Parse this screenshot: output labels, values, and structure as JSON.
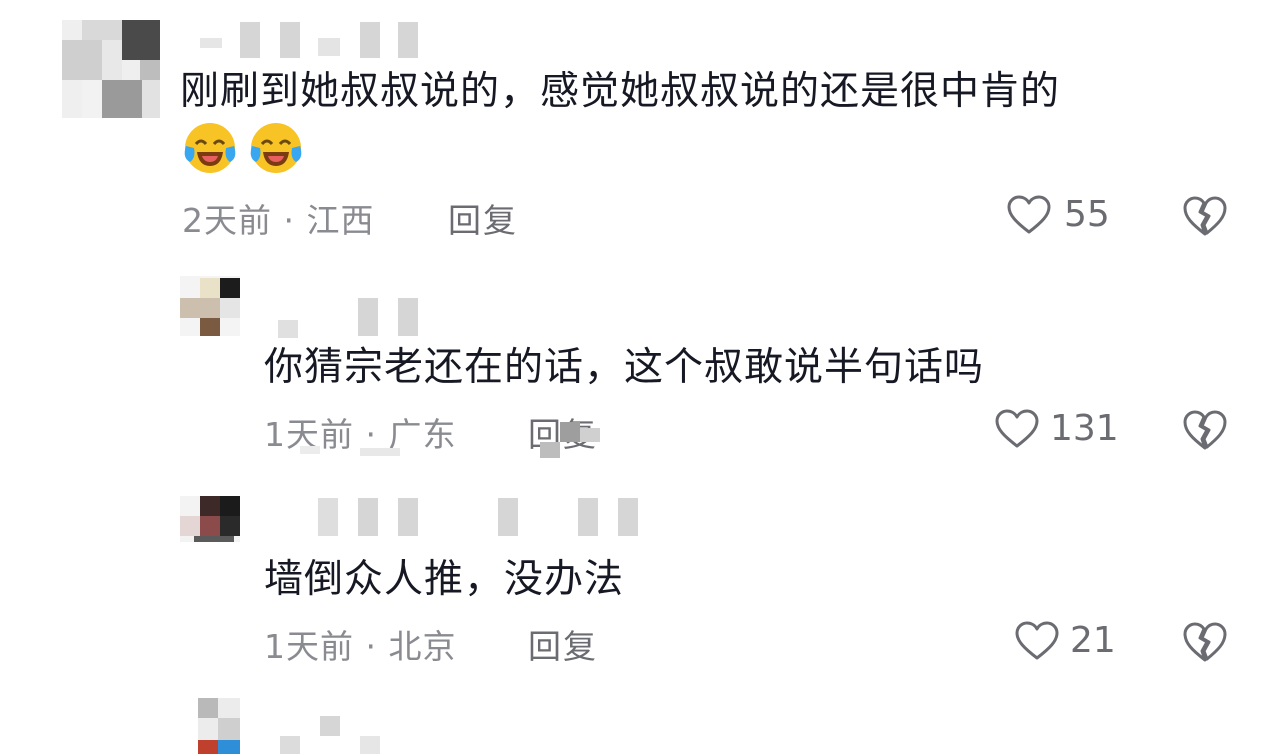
{
  "comments": [
    {
      "text": "刚刷到她叔叔说的，感觉她叔叔说的还是很中肯的",
      "emojis": [
        "laughing-crying-emoji",
        "laughing-crying-emoji"
      ],
      "time": "2天前",
      "sep": "·",
      "location": "江西",
      "reply": "回复",
      "likes": "55"
    },
    {
      "text": "你猜宗老还在的话，这个叔敢说半句话吗",
      "time": "1天前",
      "sep": "·",
      "location": "广东",
      "reply": "回复",
      "likes": "131"
    },
    {
      "text": "墙倒众人推，没办法",
      "time": "1天前",
      "sep": "·",
      "location": "北京",
      "reply": "回复",
      "likes": "21"
    }
  ],
  "colors": {
    "text": "#161823",
    "meta": "#8a8b91",
    "icon": "#6b6c72",
    "emoji_face": "#f7c325",
    "emoji_tear": "#39a7f0"
  },
  "icons": {
    "like": "heart-outline-icon",
    "dislike": "broken-heart-icon"
  }
}
